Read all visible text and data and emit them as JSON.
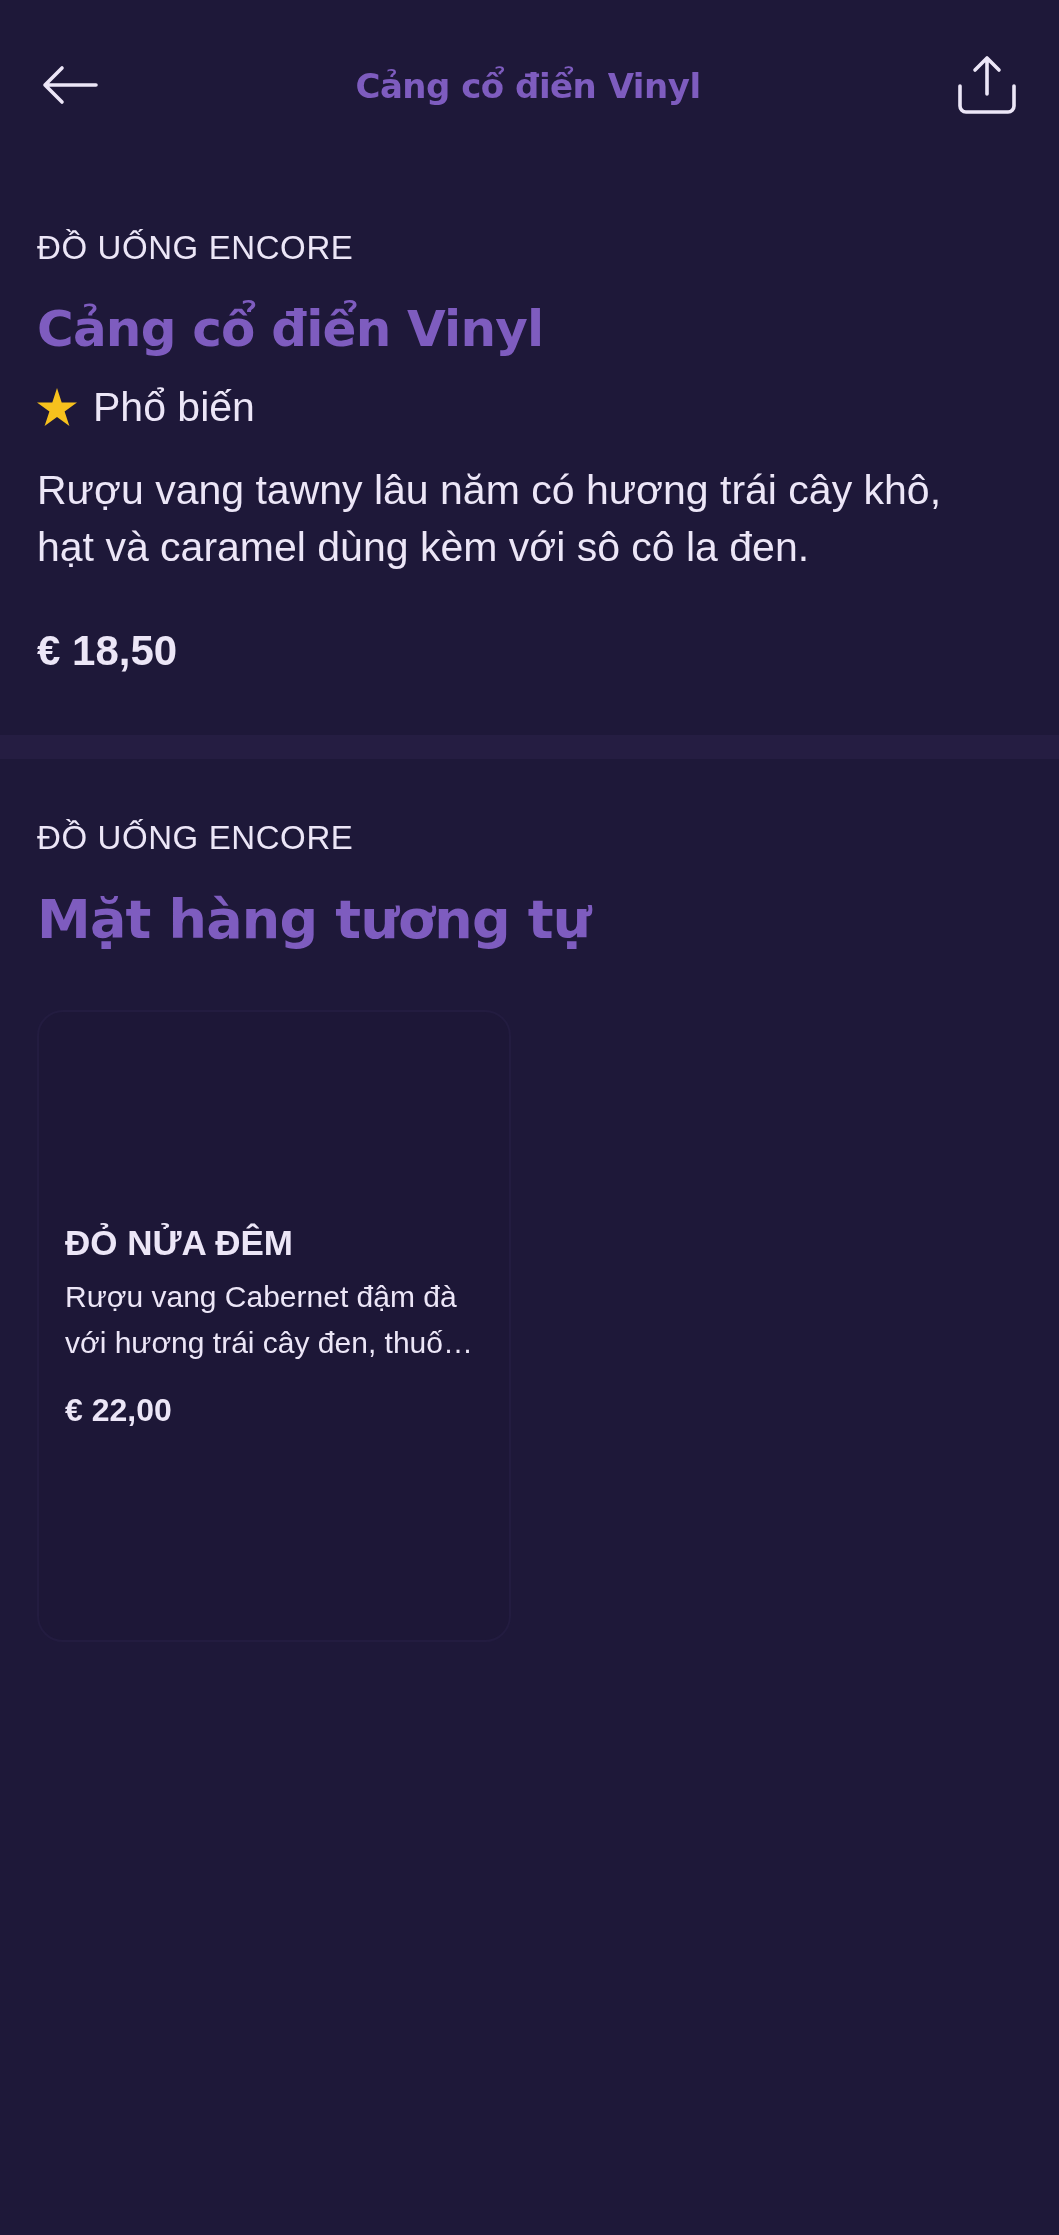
{
  "header": {
    "title": "Cảng cổ điển Vinyl"
  },
  "product": {
    "category": "ĐỒ UỐNG ENCORE",
    "name": "Cảng cổ điển Vinyl",
    "badge": {
      "label": "Phổ biến"
    },
    "description": "Rượu vang tawny lâu năm có hương trái cây khô, hạt và caramel dùng kèm với sô cô la đen.",
    "price": "€ 18,50"
  },
  "similar": {
    "category": "ĐỒ UỐNG ENCORE",
    "title": "Mặt hàng tương tự",
    "items": [
      {
        "name": "ĐỎ NỬA ĐÊM",
        "description": "Rượu vang Cabernet đậm đà với hương trái cây đen, thuố…",
        "price": "€ 22,00"
      }
    ]
  }
}
